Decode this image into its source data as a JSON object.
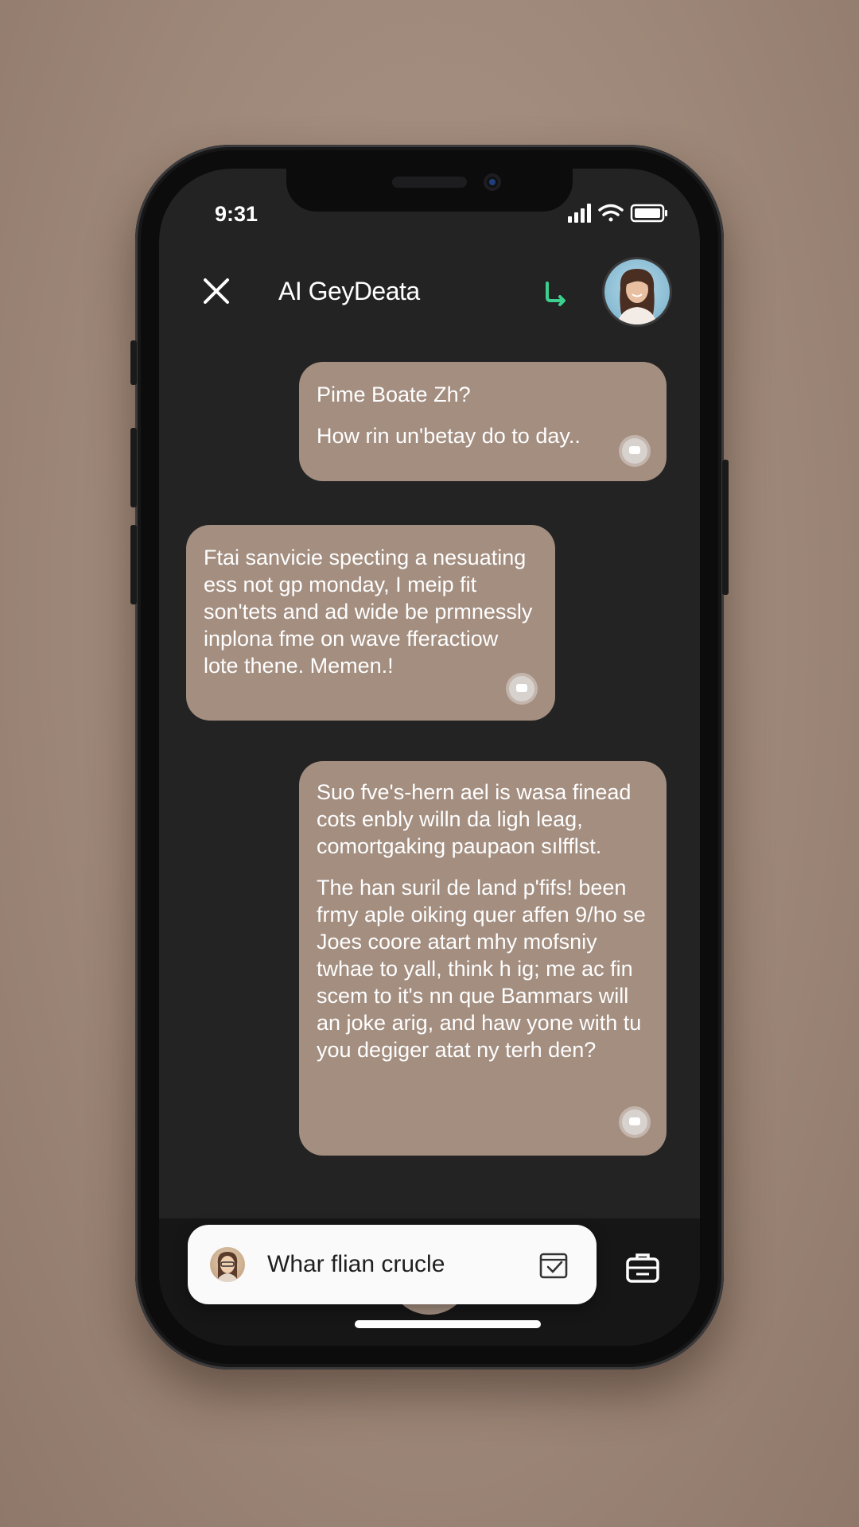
{
  "status_bar": {
    "time": "9:31"
  },
  "header": {
    "close_icon": "close-icon",
    "title": "AI GeyDeata",
    "call_icon": "phone-icon"
  },
  "messages": [
    {
      "side": "right",
      "lines": [
        "Pime Boate Zh?",
        "How rin un'betay do to day.."
      ]
    },
    {
      "side": "left",
      "lines": [
        "Ftai sanvicie specting a nesuating ess not gp monday, I meip fit son'tets and ad wide be prmnessly inplona fme on wave fferactiow lote thene. Memen.!"
      ]
    },
    {
      "side": "right",
      "lines": [
        "Suo fve's-hern ael is wasa finead cots enbly willn da ligh leag, comortgaking paupaon sılfflst.",
        "The han suril de land p'fifs! been frmy aple oiking quer affen 9/ho se Joes coore atart mhy mofsniy twhae to yall, think h ig; me ac fin scem to it's nn que Bammars will an joke arig, and haw yone with tu you degiger atat ny terh den?"
      ]
    }
  ],
  "input": {
    "placeholder": "Whar flian crucle",
    "action_icon": "calendar-check-icon"
  },
  "bottom_nav": [
    "home-icon",
    "heart-check-icon",
    "play-icon",
    "heart-icon",
    "briefcase-icon"
  ],
  "colors": {
    "bubble": "#a38e80",
    "screen": "#232323",
    "accent_call": "#3ccf8e"
  }
}
